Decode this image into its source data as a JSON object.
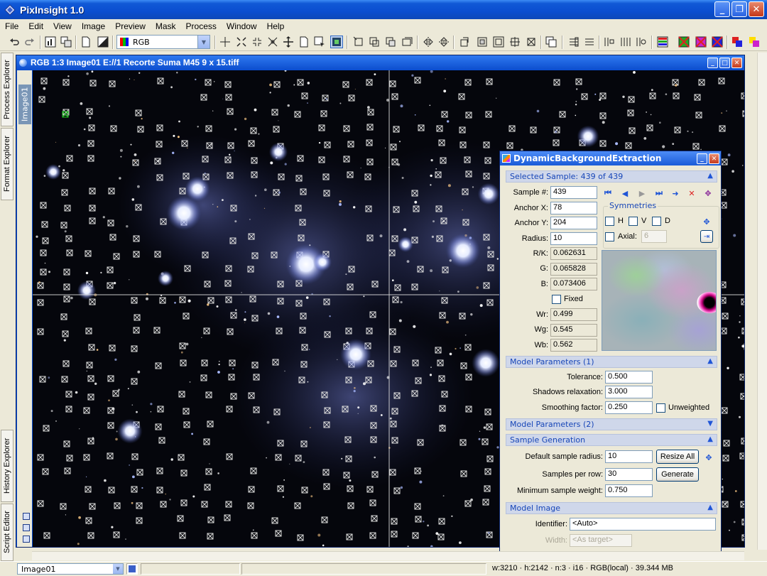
{
  "app": {
    "title": "PixInsight 1.0",
    "window_buttons": [
      "minimize",
      "maximize",
      "close"
    ]
  },
  "menu": [
    "File",
    "Edit",
    "View",
    "Image",
    "Preview",
    "Mask",
    "Process",
    "Window",
    "Help"
  ],
  "toolbar": {
    "colorspace_value": "RGB"
  },
  "side_tabs": [
    "Process Explorer",
    "Format Explorer",
    "History Explorer",
    "Script Editor"
  ],
  "image_window": {
    "title": "RGB 1:3 Image01 E://1 Recorte Suma M45 9 x 15.tiff",
    "vertical_tab": "Image01"
  },
  "dbe": {
    "title": "DynamicBackgroundExtraction",
    "selected_sample_header": "Selected Sample: 439 of 439",
    "sample_no_label": "Sample #:",
    "sample_no": "439",
    "anchor_x_label": "Anchor X:",
    "anchor_x": "78",
    "anchor_y_label": "Anchor Y:",
    "anchor_y": "204",
    "radius_label": "Radius:",
    "radius": "10",
    "rk_label": "R/K:",
    "rk": "0.062631",
    "g_label": "G:",
    "g": "0.065828",
    "b_label": "B:",
    "b": "0.073406",
    "fixed_label": "Fixed",
    "wr_label": "Wr:",
    "wr": "0.499",
    "wg_label": "Wg:",
    "wg": "0.545",
    "wb_label": "Wb:",
    "wb": "0.562",
    "symmetries_title": "Symmetries",
    "sym_h": "H",
    "sym_v": "V",
    "sym_d": "D",
    "axial_label": "Axial:",
    "axial_value": "6",
    "model_params_1": "Model Parameters (1)",
    "tolerance_label": "Tolerance:",
    "tolerance": "0.500",
    "shadows_label": "Shadows relaxation:",
    "shadows": "3.000",
    "smoothing_label": "Smoothing factor:",
    "smoothing": "0.250",
    "unweighted_label": "Unweighted",
    "model_params_2": "Model Parameters (2)",
    "sample_gen_header": "Sample Generation",
    "default_radius_label": "Default sample radius:",
    "default_radius": "10",
    "resize_all": "Resize All",
    "samples_per_row_label": "Samples per row:",
    "samples_per_row": "30",
    "generate": "Generate",
    "min_weight_label": "Minimum sample weight:",
    "min_weight": "0.750",
    "model_image_header": "Model Image",
    "identifier_label": "Identifier:",
    "identifier": "<Auto>",
    "width_label": "Width:",
    "width_value": "<As target>"
  },
  "statusbar": {
    "view_selector": "Image01",
    "info": "w:3210 · h:2142 · n:3 · i16 · RGB(local) · 39.344 MB"
  },
  "colors": {
    "xp_title": "#0a4ed0",
    "section_bg": "#cfd7ea",
    "section_text": "#1746b8",
    "sample_box": "#d9d9d9",
    "crosshair": "#e8e8e8"
  }
}
